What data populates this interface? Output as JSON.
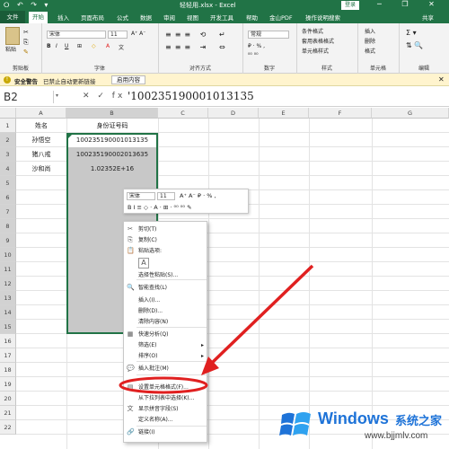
{
  "window": {
    "title": "轻轻用.xlsx - Excel",
    "login": "登录",
    "quick_access": "⭘ ↶ ↷ ▾",
    "controls": "─ ❐ ✕"
  },
  "tabs": [
    "文件",
    "开始",
    "插入",
    "页面布局",
    "公式",
    "数据",
    "审阅",
    "视图",
    "开发工具",
    "帮助",
    "金山PDF",
    "操作说明搜索"
  ],
  "tab_share": "共享",
  "ribbon": {
    "groups": [
      "剪贴板",
      "字体",
      "对齐方式",
      "数字",
      "样式",
      "单元格",
      "编辑"
    ],
    "paste": "粘贴",
    "font_name": "宋体",
    "font_size": "11",
    "number_format": "常规",
    "style_items": [
      "条件格式",
      "套用表格格式",
      "单元格样式"
    ],
    "cell_items": [
      "插入",
      "删除",
      "格式"
    ]
  },
  "security": {
    "title": "安全警告",
    "message": "已禁止自动更新链接",
    "button": "启用内容"
  },
  "formula_bar": {
    "name_box": "B2",
    "fx": "✕ ✓ fx",
    "value": "'100235190001013135"
  },
  "sheet": {
    "columns": [
      "A",
      "B",
      "C",
      "D",
      "E",
      "F",
      "G"
    ],
    "rows": [
      "1",
      "2",
      "3",
      "4",
      "5",
      "6",
      "7",
      "8",
      "9",
      "10",
      "11",
      "12",
      "13",
      "14",
      "15",
      "16",
      "17",
      "18",
      "19",
      "20",
      "21",
      "22"
    ],
    "cells": [
      [
        "姓名",
        "身份证号码"
      ],
      [
        "孙悟空",
        "100235190001013135"
      ],
      [
        "猪八戒",
        "100235190002013635"
      ],
      [
        "沙和尚",
        "1.02352E+16"
      ]
    ]
  },
  "mini_toolbar": {
    "font_name": "宋体",
    "font_size": "11",
    "row1_glyphs": "A⁺ A⁻ ₽ · % ,",
    "row2_glyphs": "B I ≡ ◇ · A · ⊞ · ⁰⁰ ⁰⁰ ✎"
  },
  "context_menu": [
    {
      "icon": "✂",
      "label": "剪切(T)"
    },
    {
      "icon": "⎘",
      "label": "复制(C)"
    },
    {
      "icon": "📋",
      "label": "粘贴选项:"
    },
    {
      "icon": "A",
      "label": ""
    },
    {
      "icon": "",
      "label": "选择性粘贴(S)..."
    },
    {
      "icon": "🔍",
      "label": "智能查找(L)"
    },
    {
      "icon": "",
      "label": "插入(I)..."
    },
    {
      "icon": "",
      "label": "删除(D)..."
    },
    {
      "icon": "",
      "label": "清除内容(N)"
    },
    {
      "icon": "▦",
      "label": "快速分析(Q)"
    },
    {
      "icon": "",
      "label": "筛选(E)",
      "submenu": true
    },
    {
      "icon": "",
      "label": "排序(O)",
      "submenu": true
    },
    {
      "icon": "💬",
      "label": "插入批注(M)"
    },
    {
      "icon": "▤",
      "label": "设置单元格格式(F)..."
    },
    {
      "icon": "",
      "label": "从下拉列表中选择(K)..."
    },
    {
      "icon": "文",
      "label": "显示拼音字段(S)"
    },
    {
      "icon": "",
      "label": "定义名称(A)..."
    },
    {
      "icon": "🔗",
      "label": "链接(I)"
    }
  ],
  "watermark": {
    "brand": "Windows",
    "site_cn": "系统之家",
    "site_url": "www.bjjmlv.com"
  },
  "colors": {
    "excel_green": "#217346",
    "highlight_red": "#e02020",
    "selection_gray": "#c8c8c8"
  }
}
